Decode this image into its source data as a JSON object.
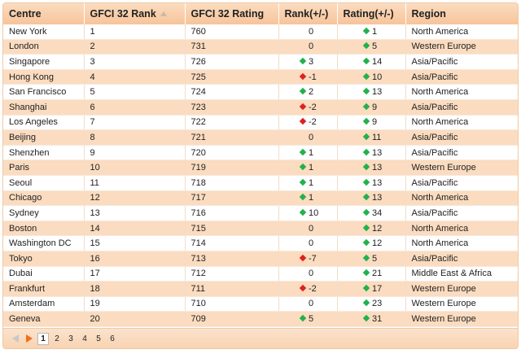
{
  "table": {
    "headers": {
      "centre": "Centre",
      "rank": "GFCI 32 Rank",
      "rating": "GFCI 32 Rating",
      "rank_change": "Rank(+/-)",
      "rating_change": "Rating(+/-)",
      "region": "Region"
    },
    "rows": [
      {
        "centre": "New York",
        "rank": "1",
        "rating": "760",
        "rank_change": "0",
        "rank_dir": "none",
        "rating_change": "1",
        "rating_dir": "up",
        "region": "North America"
      },
      {
        "centre": "London",
        "rank": "2",
        "rating": "731",
        "rank_change": "0",
        "rank_dir": "none",
        "rating_change": "5",
        "rating_dir": "up",
        "region": "Western Europe"
      },
      {
        "centre": "Singapore",
        "rank": "3",
        "rating": "726",
        "rank_change": "3",
        "rank_dir": "up",
        "rating_change": "14",
        "rating_dir": "up",
        "region": "Asia/Pacific"
      },
      {
        "centre": "Hong Kong",
        "rank": "4",
        "rating": "725",
        "rank_change": "-1",
        "rank_dir": "down",
        "rating_change": "10",
        "rating_dir": "up",
        "region": "Asia/Pacific"
      },
      {
        "centre": "San Francisco",
        "rank": "5",
        "rating": "724",
        "rank_change": "2",
        "rank_dir": "up",
        "rating_change": "13",
        "rating_dir": "up",
        "region": "North America"
      },
      {
        "centre": "Shanghai",
        "rank": "6",
        "rating": "723",
        "rank_change": "-2",
        "rank_dir": "down",
        "rating_change": "9",
        "rating_dir": "up",
        "region": "Asia/Pacific"
      },
      {
        "centre": "Los Angeles",
        "rank": "7",
        "rating": "722",
        "rank_change": "-2",
        "rank_dir": "down",
        "rating_change": "9",
        "rating_dir": "up",
        "region": "North America"
      },
      {
        "centre": "Beijing",
        "rank": "8",
        "rating": "721",
        "rank_change": "0",
        "rank_dir": "none",
        "rating_change": "11",
        "rating_dir": "up",
        "region": "Asia/Pacific"
      },
      {
        "centre": "Shenzhen",
        "rank": "9",
        "rating": "720",
        "rank_change": "1",
        "rank_dir": "up",
        "rating_change": "13",
        "rating_dir": "up",
        "region": "Asia/Pacific"
      },
      {
        "centre": "Paris",
        "rank": "10",
        "rating": "719",
        "rank_change": "1",
        "rank_dir": "up",
        "rating_change": "13",
        "rating_dir": "up",
        "region": "Western Europe"
      },
      {
        "centre": "Seoul",
        "rank": "11",
        "rating": "718",
        "rank_change": "1",
        "rank_dir": "up",
        "rating_change": "13",
        "rating_dir": "up",
        "region": "Asia/Pacific"
      },
      {
        "centre": "Chicago",
        "rank": "12",
        "rating": "717",
        "rank_change": "1",
        "rank_dir": "up",
        "rating_change": "13",
        "rating_dir": "up",
        "region": "North America"
      },
      {
        "centre": "Sydney",
        "rank": "13",
        "rating": "716",
        "rank_change": "10",
        "rank_dir": "up",
        "rating_change": "34",
        "rating_dir": "up",
        "region": "Asia/Pacific"
      },
      {
        "centre": "Boston",
        "rank": "14",
        "rating": "715",
        "rank_change": "0",
        "rank_dir": "none",
        "rating_change": "12",
        "rating_dir": "up",
        "region": "North America"
      },
      {
        "centre": "Washington DC",
        "rank": "15",
        "rating": "714",
        "rank_change": "0",
        "rank_dir": "none",
        "rating_change": "12",
        "rating_dir": "up",
        "region": "North America"
      },
      {
        "centre": "Tokyo",
        "rank": "16",
        "rating": "713",
        "rank_change": "-7",
        "rank_dir": "down",
        "rating_change": "5",
        "rating_dir": "up",
        "region": "Asia/Pacific"
      },
      {
        "centre": "Dubai",
        "rank": "17",
        "rating": "712",
        "rank_change": "0",
        "rank_dir": "none",
        "rating_change": "21",
        "rating_dir": "up",
        "region": "Middle East & Africa"
      },
      {
        "centre": "Frankfurt",
        "rank": "18",
        "rating": "711",
        "rank_change": "-2",
        "rank_dir": "down",
        "rating_change": "17",
        "rating_dir": "up",
        "region": "Western Europe"
      },
      {
        "centre": "Amsterdam",
        "rank": "19",
        "rating": "710",
        "rank_change": "0",
        "rank_dir": "none",
        "rating_change": "23",
        "rating_dir": "up",
        "region": "Western Europe"
      },
      {
        "centre": "Geneva",
        "rank": "20",
        "rating": "709",
        "rank_change": "5",
        "rank_dir": "up",
        "rating_change": "31",
        "rating_dir": "up",
        "region": "Western Europe"
      }
    ]
  },
  "pager": {
    "prev_icon": "triangle-left-icon",
    "next_icon": "triangle-right-icon",
    "pages": [
      "1",
      "2",
      "3",
      "4",
      "5",
      "6"
    ],
    "current": "1"
  },
  "colors": {
    "header": "#f7c49a",
    "row_alt": "#fbdcc0",
    "up": "#22b14c",
    "down": "#e0201f"
  }
}
